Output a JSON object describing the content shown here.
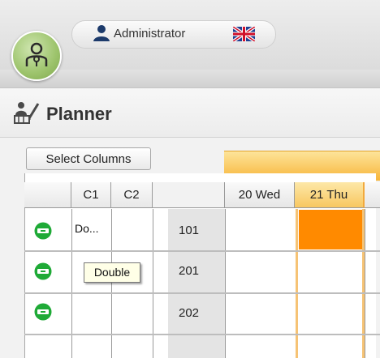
{
  "header": {
    "user_name": "Administrator",
    "user_icon": "user-icon",
    "flag_icon": "uk-flag-icon",
    "avatar_icon": "staff-avatar-icon"
  },
  "page": {
    "title": "Planner",
    "icon": "planner-icon"
  },
  "toolbar": {
    "select_columns_label": "Select Columns"
  },
  "grid": {
    "columns": [
      "C1",
      "C2"
    ],
    "dates": [
      "20 Wed",
      "21 Thu"
    ],
    "rows": [
      {
        "room": "101",
        "c1": "Do...",
        "c2": "",
        "status_icon": "room-status-icon"
      },
      {
        "room": "201",
        "c1": "",
        "c2": "",
        "status_icon": "room-status-icon"
      },
      {
        "room": "202",
        "c1": "",
        "c2": "",
        "status_icon": "room-status-icon"
      }
    ],
    "tooltip": "Double"
  },
  "colors": {
    "status_green": "#1faa37",
    "timeline_orange": "#f7b539",
    "booking_orange": "#ff8a00"
  }
}
